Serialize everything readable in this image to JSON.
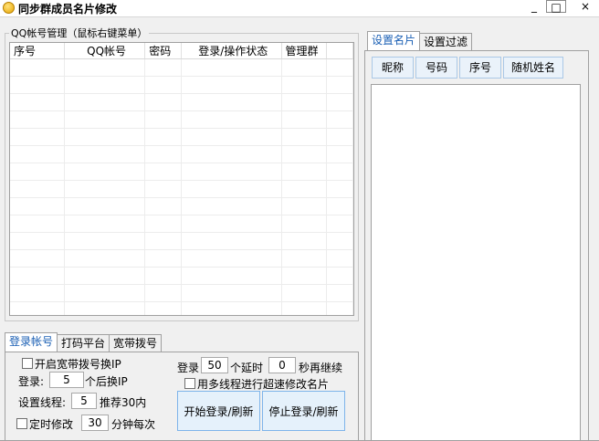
{
  "window": {
    "title": "同步群成员名片修改",
    "minimize": "_",
    "maximize": "□",
    "close": "×"
  },
  "accounts_group": {
    "label": "QQ帐号管理（鼠标右键菜单）",
    "columns": [
      "序号",
      "QQ帐号",
      "密码",
      "登录/操作状态",
      "管理群"
    ]
  },
  "bottom_tabs": [
    "登录帐号",
    "打码平台",
    "宽带拨号"
  ],
  "login_panel": {
    "broadband_switch_label": "开启宽带拨号换IP",
    "login_prefix": "登录:",
    "switch_count": "5",
    "switch_suffix": "个后换IP",
    "threads_prefix": "设置线程:",
    "threads_value": "5",
    "threads_suffix": "推荐30内",
    "timed_label": "定时修改",
    "timed_value": "30",
    "timed_suffix": "分钟每次",
    "login_label": "登录",
    "login_count": "50",
    "delay_label": "个延时",
    "delay_value": "0",
    "delay_suffix": "秒再继续",
    "multithread_label": "用多线程进行超速修改名片",
    "start_button": "开始登录/刷新",
    "stop_button": "停止登录/刷新"
  },
  "right_tabs": [
    "设置名片",
    "设置过滤"
  ],
  "right_columns": [
    "昵称",
    "号码",
    "序号",
    "随机姓名"
  ]
}
